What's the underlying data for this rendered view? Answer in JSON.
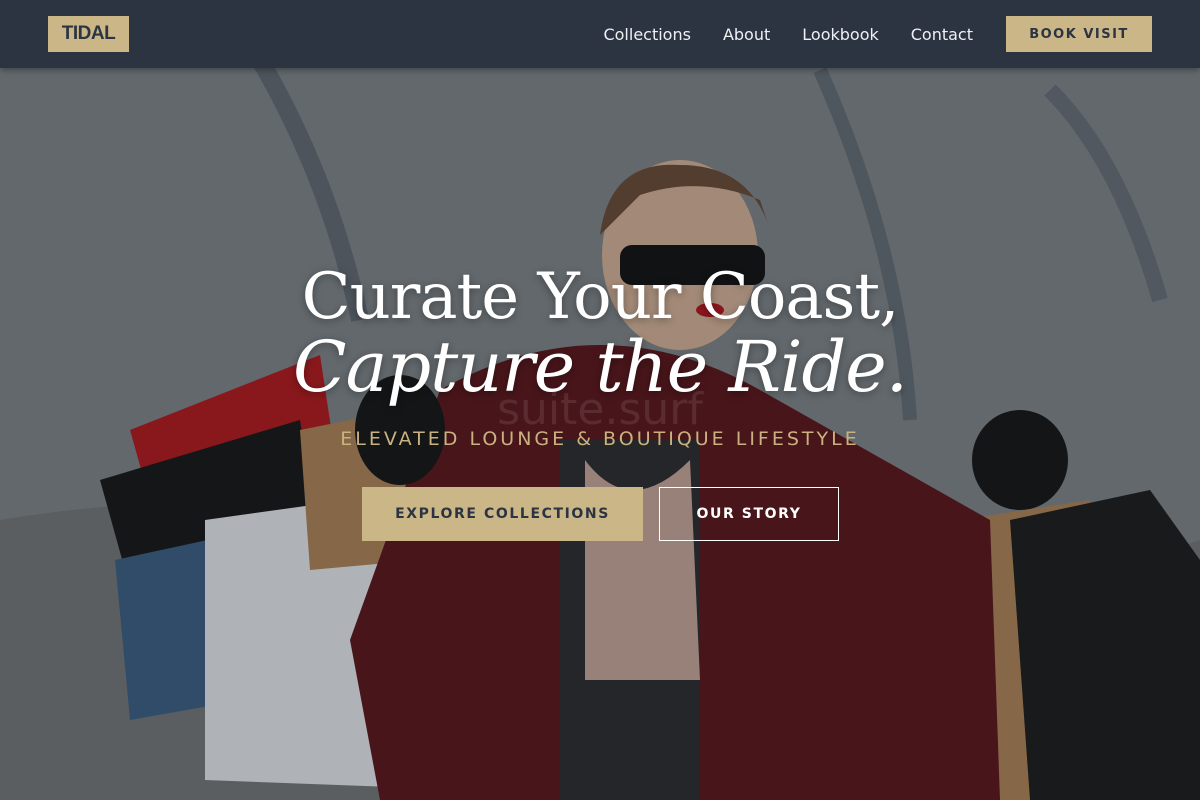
{
  "header": {
    "logo": "TIDAL",
    "nav": [
      "Collections",
      "About",
      "Lookbook",
      "Contact"
    ],
    "cta": "BOOK VISIT"
  },
  "hero": {
    "headline_line1": "Curate Your Coast,",
    "headline_line2": "Capture the Ride.",
    "tagline": "ELEVATED LOUNGE & BOUTIQUE LIFESTYLE",
    "primary_button": "EXPLORE COLLECTIONS",
    "secondary_button": "OUR STORY",
    "watermark": "suite.surf",
    "background_image": "woman in red coat and sunglasses holding shopping bags"
  },
  "colors": {
    "nav_background": "#2c3442",
    "accent_gold": "#cbb687",
    "tagline_gold": "#c9b27f",
    "text_white": "#ffffff"
  }
}
